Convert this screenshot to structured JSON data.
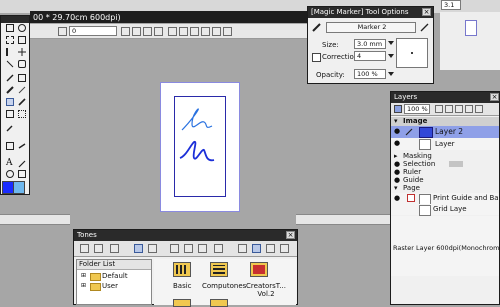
{
  "document": {
    "title_fragment": "00 * 29.70cm 600dpi)",
    "page_number": "3.1",
    "zoom_value": "0"
  },
  "tool_options": {
    "title": "[Magic Marker] Tool Options",
    "preset": "Marker 2",
    "size_label": "Size:",
    "size_value": "3.0 mm",
    "correction_label": "Correction",
    "correction_value": "4",
    "opacity_label": "Opacity:",
    "opacity_value": "100 %"
  },
  "layers": {
    "title": "Layers",
    "opacity": "100 %",
    "rows": [
      {
        "label": "Image"
      },
      {
        "label": "Layer 2"
      },
      {
        "label": "Layer"
      },
      {
        "label": "Masking"
      },
      {
        "label": "Selection"
      },
      {
        "label": "Ruler"
      },
      {
        "label": "Guide"
      },
      {
        "label": "Page"
      },
      {
        "label": "Print Guide and Basi..."
      },
      {
        "label": "Grid Laye"
      }
    ],
    "status": "Raster Layer 600dpi(Monochrome (2t"
  },
  "tones": {
    "title": "Tones",
    "folder_list_label": "Folder List",
    "folders": [
      "Default",
      "User"
    ],
    "items": [
      "Basic",
      "Computones",
      "CreatorsT... Vol.2"
    ]
  },
  "colors": {
    "foreground": "#1a2cff",
    "background": "#6fb8ee",
    "stroke": "#1b2fd8"
  }
}
